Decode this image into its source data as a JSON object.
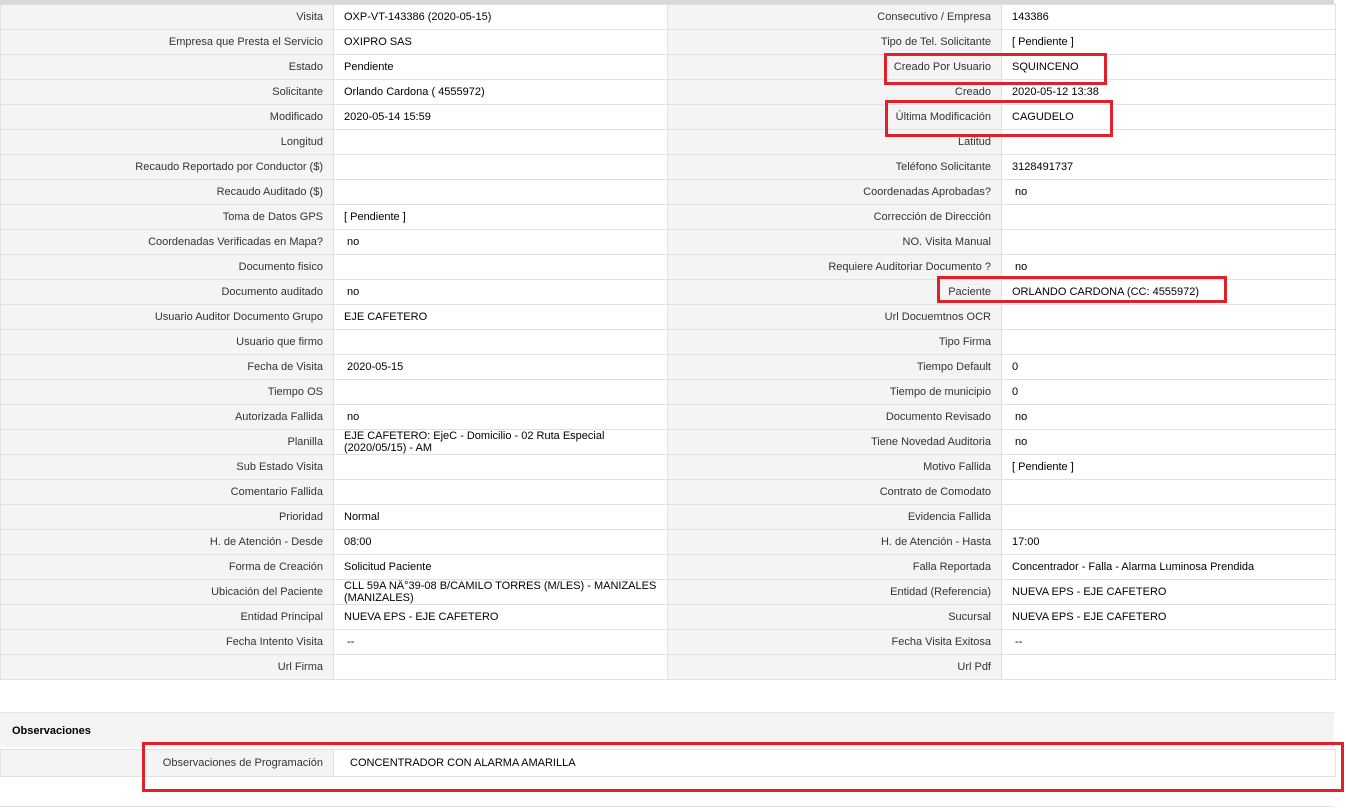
{
  "rows": [
    {
      "l1": "Visita",
      "v1": "OXP-VT-143386 (2020-05-15)",
      "l2": "Consecutivo / Empresa",
      "v2": "143386"
    },
    {
      "l1": "Empresa que Presta el Servicio",
      "v1": "OXIPRO SAS",
      "l2": "Tipo de Tel. Solicitante",
      "v2": "[ Pendiente ]"
    },
    {
      "l1": "Estado",
      "v1": "Pendiente",
      "l2": "Creado Por Usuario",
      "v2": "SQUINCENO"
    },
    {
      "l1": "Solicitante",
      "v1": "Orlando Cardona ( 4555972)",
      "l2": "Creado",
      "v2": "2020-05-12 13:38"
    },
    {
      "l1": "Modificado",
      "v1": "2020-05-14 15:59",
      "l2": "Última Modificación",
      "v2": "CAGUDELO"
    },
    {
      "l1": "Longitud",
      "v1": "",
      "l2": "Latitud",
      "v2": ""
    },
    {
      "l1": "Recaudo Reportado por Conductor ($)",
      "v1": "",
      "l2": "Teléfono Solicitante",
      "v2": "3128491737"
    },
    {
      "l1": "Recaudo Auditado ($)",
      "v1": "",
      "l2": "Coordenadas Aprobadas?",
      "v2": "no"
    },
    {
      "l1": "Toma de Datos GPS",
      "v1": "[ Pendiente ]",
      "l2": "Corrección de Dirección",
      "v2": ""
    },
    {
      "l1": "Coordenadas Verificadas en Mapa?",
      "v1": "no",
      "l2": "NO. Visita Manual",
      "v2": ""
    },
    {
      "l1": "Documento fisico",
      "v1": "",
      "l2": "Requiere Auditoriar Documento ?",
      "v2": "no"
    },
    {
      "l1": "Documento auditado",
      "v1": "no",
      "l2": "Paciente",
      "v2": "ORLANDO CARDONA (CC: 4555972)"
    },
    {
      "l1": "Usuario Auditor Documento Grupo",
      "v1": "EJE CAFETERO",
      "l2": "Url Docuemtnos OCR",
      "v2": ""
    },
    {
      "l1": "Usuario que firmo",
      "v1": "",
      "l2": "Tipo Firma",
      "v2": ""
    },
    {
      "l1": "Fecha de Visita",
      "v1": "2020-05-15",
      "l2": "Tiempo Default",
      "v2": "0"
    },
    {
      "l1": "Tiempo OS",
      "v1": "",
      "l2": "Tiempo de municipio",
      "v2": "0"
    },
    {
      "l1": "Autorizada Fallida",
      "v1": "no",
      "l2": "Documento Revisado",
      "v2": "no"
    },
    {
      "l1": "Planilla",
      "v1": "EJE CAFETERO: EjeC - Domicilio - 02 Ruta Especial (2020/05/15) - AM",
      "l2": "Tiene Novedad Auditoria",
      "v2": "no"
    },
    {
      "l1": "Sub Estado Visita",
      "v1": "",
      "l2": "Motivo Fallida",
      "v2": "[ Pendiente ]"
    },
    {
      "l1": "Comentario Fallida",
      "v1": "",
      "l2": "Contrato de Comodato",
      "v2": ""
    },
    {
      "l1": "Prioridad",
      "v1": "Normal",
      "l2": "Evidencia Fallida",
      "v2": ""
    },
    {
      "l1": "H. de Atención - Desde",
      "v1": "08:00",
      "l2": "H. de Atención - Hasta",
      "v2": "17:00"
    },
    {
      "l1": "Forma de Creación",
      "v1": "Solicitud Paciente",
      "l2": "Falla Reportada",
      "v2": "Concentrador - Falla - Alarma Luminosa Prendida"
    },
    {
      "l1": "Ubicación del Paciente",
      "v1": "CLL 59A NÂ°39-08 B/CAMILO TORRES (M/LES) - MANIZALES (MANIZALES)",
      "l2": "Entidad (Referencia)",
      "v2": "NUEVA EPS - EJE CAFETERO"
    },
    {
      "l1": "Entidad Principal",
      "v1": "NUEVA EPS - EJE CAFETERO",
      "l2": "Sucursal",
      "v2": "NUEVA EPS - EJE CAFETERO"
    },
    {
      "l1": "Fecha Intento Visita",
      "v1": "--",
      "l2": "Fecha Visita Exitosa",
      "v2": "--"
    },
    {
      "l1": "Url Firma",
      "v1": "",
      "l2": "Url Pdf",
      "v2": ""
    }
  ],
  "observaciones": {
    "title": "Observaciones",
    "label": "Observaciones de Programación",
    "value": "CONCENTRADOR CON ALARMA AMARILLA"
  },
  "highlight_color": "#e0202a"
}
